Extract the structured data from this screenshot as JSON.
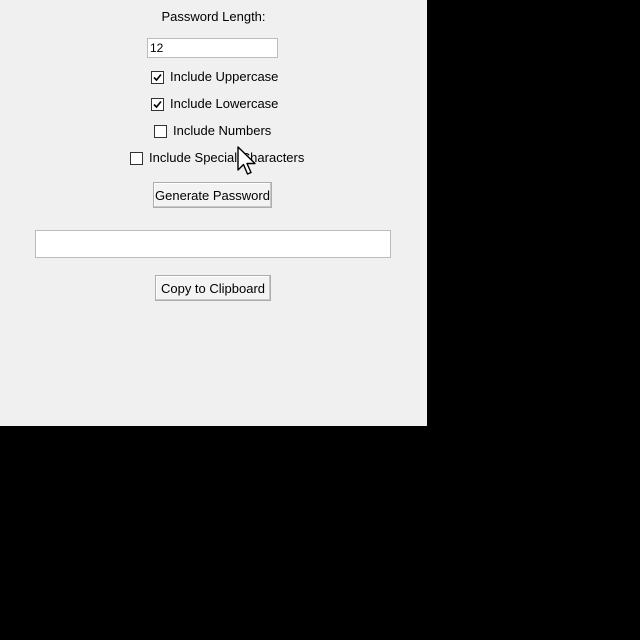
{
  "form": {
    "length_label": "Password Length:",
    "length_value": "12",
    "options": [
      {
        "label": "Include Uppercase",
        "checked": true
      },
      {
        "label": "Include Lowercase",
        "checked": true
      },
      {
        "label": "Include Numbers",
        "checked": false
      },
      {
        "label": "Include Special Characters",
        "checked": false
      }
    ],
    "generate_label": "Generate Password",
    "output_value": "",
    "copy_label": "Copy to Clipboard"
  },
  "icons": {
    "checkmark": "checkmark-icon",
    "cursor": "mouse-pointer-icon"
  },
  "colors": {
    "window_bg": "#f0f0f0",
    "desktop_bg": "#000000"
  }
}
